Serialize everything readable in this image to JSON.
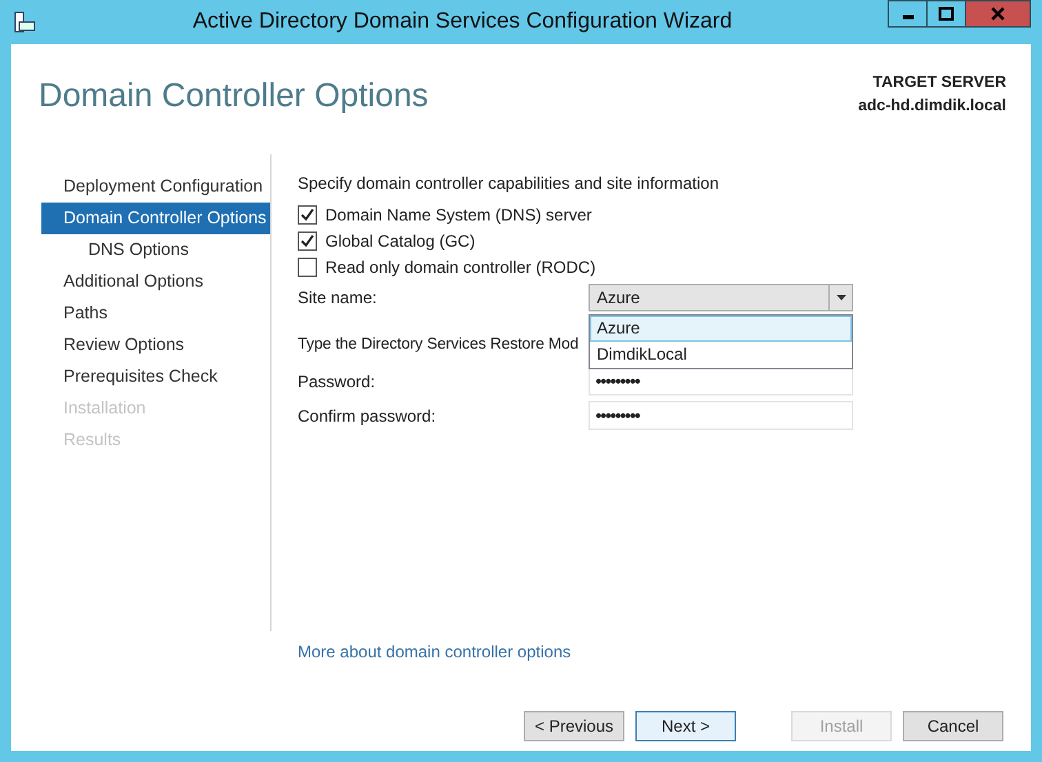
{
  "window": {
    "title": "Active Directory Domain Services Configuration Wizard"
  },
  "page_title": "Domain Controller Options",
  "target_server": {
    "label": "TARGET SERVER",
    "name": "adc-hd.dimdik.local"
  },
  "steps": [
    {
      "label": "Deployment Configuration",
      "selected": false,
      "disabled": false
    },
    {
      "label": "Domain Controller Options",
      "selected": true,
      "disabled": false,
      "children": [
        {
          "label": "DNS Options",
          "selected": false,
          "disabled": false
        }
      ]
    },
    {
      "label": "Additional Options",
      "selected": false,
      "disabled": false
    },
    {
      "label": "Paths",
      "selected": false,
      "disabled": false
    },
    {
      "label": "Review Options",
      "selected": false,
      "disabled": false
    },
    {
      "label": "Prerequisites Check",
      "selected": false,
      "disabled": false
    },
    {
      "label": "Installation",
      "selected": false,
      "disabled": true
    },
    {
      "label": "Results",
      "selected": false,
      "disabled": true
    }
  ],
  "intro": "Specify domain controller capabilities and site information",
  "options": [
    {
      "label": "Domain Name System (DNS) server",
      "checked": true
    },
    {
      "label": "Global Catalog (GC)",
      "checked": true
    },
    {
      "label": "Read only domain controller (RODC)",
      "checked": false
    }
  ],
  "site": {
    "label": "Site name:",
    "value": "Azure",
    "options": [
      {
        "label": "Azure",
        "selected": true
      },
      {
        "label": "DimdikLocal",
        "selected": false
      }
    ]
  },
  "dsrm_text": "Type the Directory Services Restore Mod",
  "password": {
    "label": "Password:",
    "value": "•••••••••"
  },
  "confirm_password": {
    "label": "Confirm password:",
    "value": "•••••••••"
  },
  "more_link": "More about domain controller options",
  "buttons": [
    {
      "label": "< Previous",
      "disabled": false
    },
    {
      "label": "Next >",
      "disabled": false
    },
    {
      "label": "Install",
      "disabled": true
    },
    {
      "label": "Cancel",
      "disabled": false
    }
  ]
}
